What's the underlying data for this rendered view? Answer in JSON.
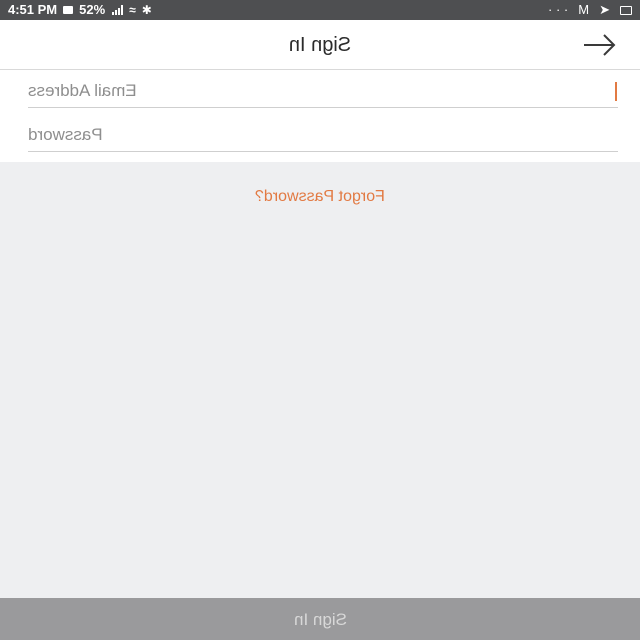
{
  "status_bar": {
    "time": "4:51 PM",
    "battery": "52%",
    "right_icons": [
      "mail-icon",
      "messenger-icon",
      "gmail-icon"
    ],
    "more": "· · ·"
  },
  "header": {
    "title": "Sign In",
    "nav_icon": "arrow-icon"
  },
  "form": {
    "email_placeholder": "Email Address",
    "password_placeholder": "Password"
  },
  "links": {
    "forgot_password": "Forgot Password?"
  },
  "footer": {
    "signin_label": "Sign In"
  },
  "colors": {
    "accent": "#e27a43",
    "status_bar": "#4e4f51",
    "button_bg": "#9a9a9c",
    "background": "#eeeff1"
  }
}
